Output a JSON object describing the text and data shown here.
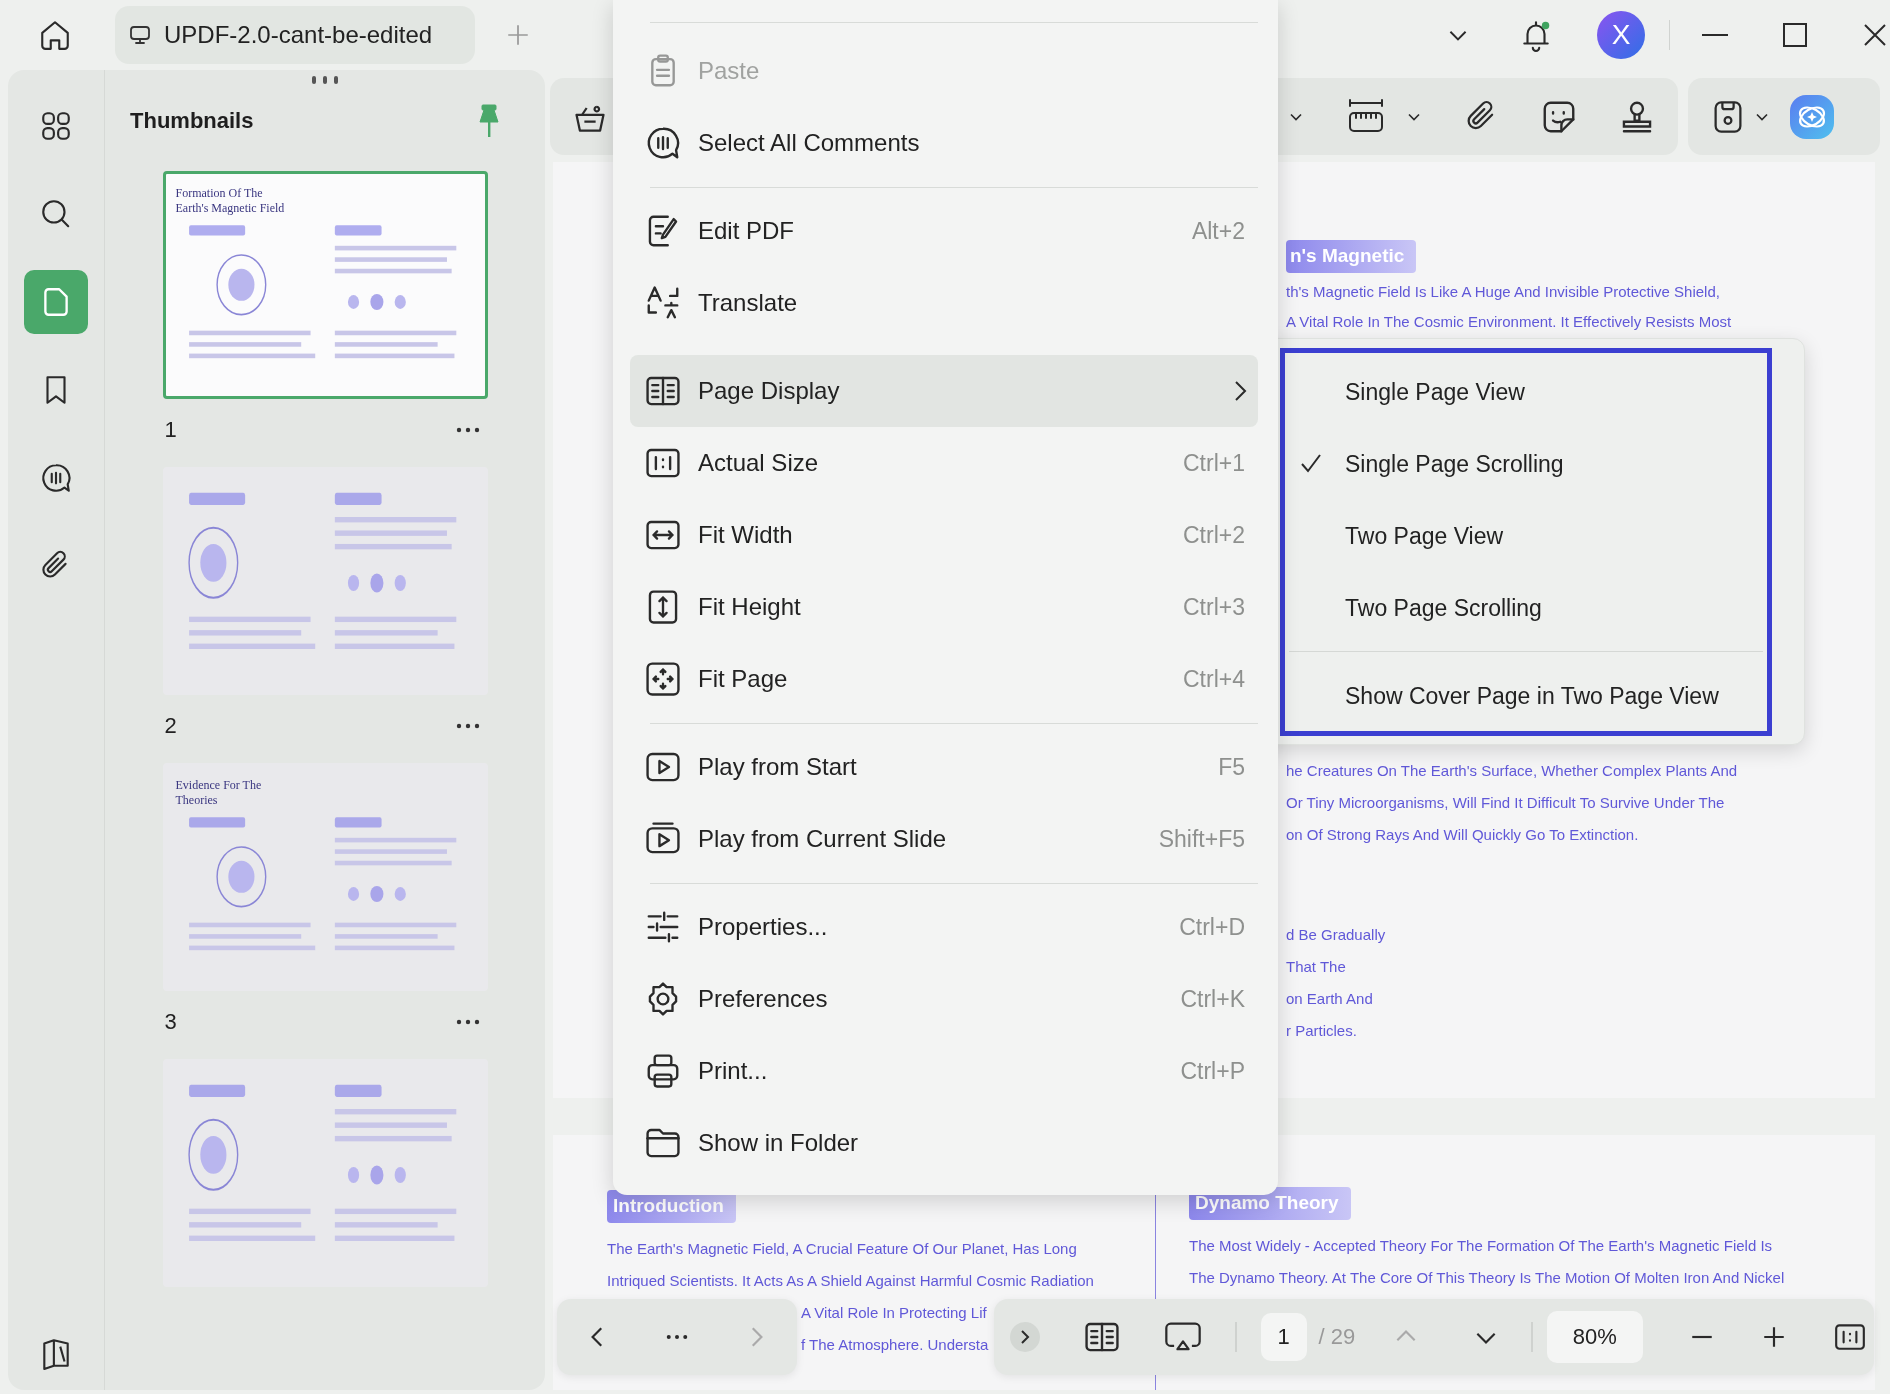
{
  "top_bar": {
    "tab": {
      "title": "UPDF-2.0-cant-be-edited"
    },
    "avatar": {
      "initial": "X"
    },
    "notification": {
      "unread": true
    }
  },
  "rail": [
    {
      "selected": false
    },
    {
      "selected": false
    },
    {
      "selected": true
    },
    {
      "selected": false
    },
    {
      "selected": false
    },
    {
      "selected": false
    }
  ],
  "thumbnails": {
    "title": "Thumbnails",
    "pinned": true,
    "pages": [
      {
        "label": "1",
        "selected": true,
        "title": "Formation Of The Earth's Magnetic Field"
      },
      {
        "label": "2",
        "selected": false
      },
      {
        "label": "3",
        "selected": false,
        "title": "Evidence For The Theories"
      },
      {
        "selected": false
      }
    ]
  },
  "document": {
    "page_1": {
      "heading": "n's Magnetic",
      "paragraphs": [
        [
          "th's Magnetic Field Is Like A Huge And Invisible Protective Shield,",
          "A Vital Role In The Cosmic Environment. It Effectively Resists Most"
        ],
        [
          "he Creatures On The Earth's Surface, Whether Complex Plants And",
          "Or Tiny Microorganisms, Will Find It Difficult To Survive Under The",
          "on Of Strong Rays And Will Quickly Go To Extinction."
        ],
        [
          "d Be Gradually",
          "That The",
          "on Earth And",
          "r Particles."
        ]
      ]
    },
    "page_2": {
      "columns": [
        {
          "heading": "Introduction",
          "lines": [
            {
              "kind": "full",
              "text": "The Earth's Magnetic Field, A Crucial Feature Of Our Planet, Has Long"
            },
            {
              "kind": "full",
              "text": "Intriqued Scientists. It Acts As A Shield Against Harmful Cosmic Radiation"
            },
            {
              "kind": "cut",
              "text": "A Vital Role In Protecting Lif"
            },
            {
              "kind": "cut",
              "text": "f The Atmosphere. Understa"
            }
          ]
        },
        {
          "heading": "Dynamo Theory",
          "lines": [
            {
              "kind": "full",
              "text": "The Most Widely - Accepted Theory For The Formation Of The Earth's Magnetic Field Is"
            },
            {
              "kind": "full",
              "text": "The Dynamo Theory. At The Core Of This Theory Is The Motion Of Molten Iron And Nickel"
            }
          ]
        }
      ]
    }
  },
  "context_menu": {
    "items": [
      {
        "kind": "item",
        "label": "Paste",
        "disabled": true,
        "selected": false
      },
      {
        "kind": "item",
        "label": "Select All Comments",
        "disabled": false,
        "selected": false
      },
      {
        "kind": "divider"
      },
      {
        "kind": "item",
        "label": "Edit PDF",
        "shortcut": "Alt+2",
        "disabled": false,
        "selected": false
      },
      {
        "kind": "item",
        "label": "Translate",
        "disabled": false,
        "selected": false
      },
      {
        "kind": "submenu",
        "label": "Page Display",
        "disabled": false,
        "selected": true
      },
      {
        "kind": "item",
        "label": "Actual Size",
        "shortcut": "Ctrl+1",
        "disabled": false,
        "selected": false
      },
      {
        "kind": "item",
        "label": "Fit Width",
        "shortcut": "Ctrl+2",
        "disabled": false,
        "selected": false
      },
      {
        "kind": "item",
        "label": "Fit Height",
        "shortcut": "Ctrl+3",
        "disabled": false,
        "selected": false
      },
      {
        "kind": "item",
        "label": "Fit Page",
        "shortcut": "Ctrl+4",
        "disabled": false,
        "selected": false
      },
      {
        "kind": "divider"
      },
      {
        "kind": "item",
        "label": "Play from Start",
        "shortcut": "F5",
        "disabled": false,
        "selected": false
      },
      {
        "kind": "item",
        "label": "Play from Current Slide",
        "shortcut": "Shift+F5",
        "disabled": false,
        "selected": false
      },
      {
        "kind": "divider"
      },
      {
        "kind": "item",
        "label": "Properties...",
        "shortcut": "Ctrl+D",
        "disabled": false,
        "selected": false
      },
      {
        "kind": "item",
        "label": "Preferences",
        "shortcut": "Ctrl+K",
        "disabled": false,
        "selected": false
      },
      {
        "kind": "item",
        "label": "Print...",
        "shortcut": "Ctrl+P",
        "disabled": false,
        "selected": false
      },
      {
        "kind": "item",
        "label": "Show in Folder",
        "disabled": false,
        "selected": false
      }
    ]
  },
  "submenu": {
    "items": [
      {
        "kind": "option",
        "label": "Single Page View",
        "checked": false
      },
      {
        "kind": "option",
        "label": "Single Page Scrolling",
        "checked": true
      },
      {
        "kind": "option",
        "label": "Two Page View",
        "checked": false
      },
      {
        "kind": "option",
        "label": "Two Page Scrolling",
        "checked": false
      },
      {
        "kind": "divider"
      },
      {
        "kind": "option",
        "label": "Show Cover Page in Two Page View",
        "checked": false
      }
    ]
  },
  "bottom_bar": {
    "previous": {
      "disabled": false
    },
    "next": {
      "disabled": true
    },
    "page_input": "1",
    "page_total": "/ 29",
    "page_up": {
      "disabled": true
    },
    "page_down": {
      "disabled": false
    },
    "zoom": "80%"
  }
}
